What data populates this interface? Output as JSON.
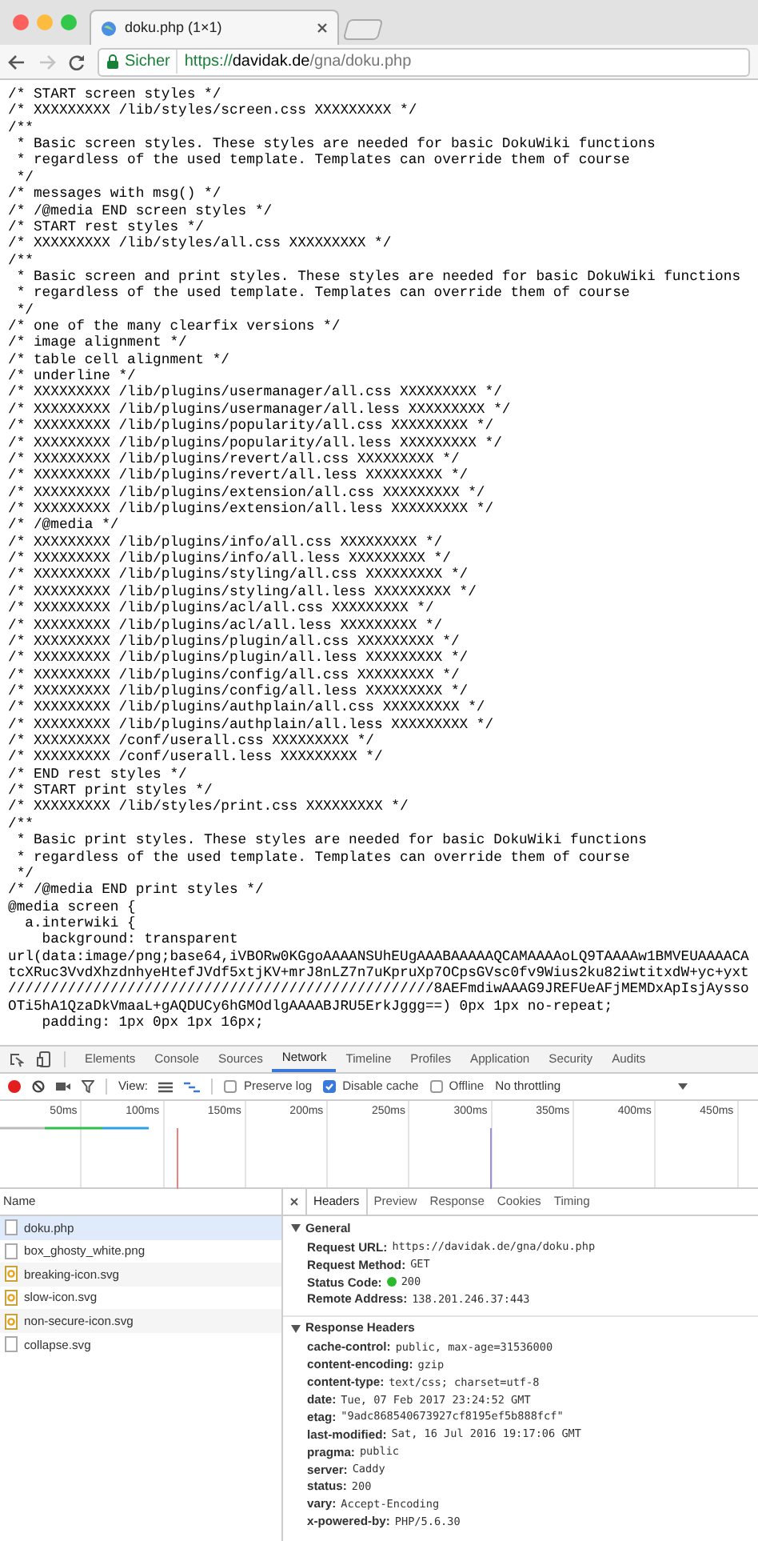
{
  "browser": {
    "tab_title": "doku.php (1×1)",
    "security_label": "Sicher",
    "url": {
      "scheme": "https://",
      "host": "davidak.de",
      "path": "/gna/doku.php"
    }
  },
  "source_lines": [
    "/* START screen styles */",
    "/* XXXXXXXXX /lib/styles/screen.css XXXXXXXXX */",
    "/**",
    " * Basic screen styles. These styles are needed for basic DokuWiki functions",
    " * regardless of the used template. Templates can override them of course",
    " */",
    "/* messages with msg() */",
    "/* /@media END screen styles */",
    "/* START rest styles */",
    "/* XXXXXXXXX /lib/styles/all.css XXXXXXXXX */",
    "/**",
    " * Basic screen and print styles. These styles are needed for basic DokuWiki functions",
    " * regardless of the used template. Templates can override them of course",
    " */",
    "/* one of the many clearfix versions */",
    "/* image alignment */",
    "/* table cell alignment */",
    "/* underline */",
    "/* XXXXXXXXX /lib/plugins/usermanager/all.css XXXXXXXXX */",
    "/* XXXXXXXXX /lib/plugins/usermanager/all.less XXXXXXXXX */",
    "/* XXXXXXXXX /lib/plugins/popularity/all.css XXXXXXXXX */",
    "/* XXXXXXXXX /lib/plugins/popularity/all.less XXXXXXXXX */",
    "/* XXXXXXXXX /lib/plugins/revert/all.css XXXXXXXXX */",
    "/* XXXXXXXXX /lib/plugins/revert/all.less XXXXXXXXX */",
    "/* XXXXXXXXX /lib/plugins/extension/all.css XXXXXXXXX */",
    "/* XXXXXXXXX /lib/plugins/extension/all.less XXXXXXXXX */",
    "/* /@media */",
    "/* XXXXXXXXX /lib/plugins/info/all.css XXXXXXXXX */",
    "/* XXXXXXXXX /lib/plugins/info/all.less XXXXXXXXX */",
    "/* XXXXXXXXX /lib/plugins/styling/all.css XXXXXXXXX */",
    "/* XXXXXXXXX /lib/plugins/styling/all.less XXXXXXXXX */",
    "/* XXXXXXXXX /lib/plugins/acl/all.css XXXXXXXXX */",
    "/* XXXXXXXXX /lib/plugins/acl/all.less XXXXXXXXX */",
    "/* XXXXXXXXX /lib/plugins/plugin/all.css XXXXXXXXX */",
    "/* XXXXXXXXX /lib/plugins/plugin/all.less XXXXXXXXX */",
    "/* XXXXXXXXX /lib/plugins/config/all.css XXXXXXXXX */",
    "/* XXXXXXXXX /lib/plugins/config/all.less XXXXXXXXX */",
    "/* XXXXXXXXX /lib/plugins/authplain/all.css XXXXXXXXX */",
    "/* XXXXXXXXX /lib/plugins/authplain/all.less XXXXXXXXX */",
    "/* XXXXXXXXX /conf/userall.css XXXXXXXXX */",
    "/* XXXXXXXXX /conf/userall.less XXXXXXXXX */",
    "/* END rest styles */",
    "/* START print styles */",
    "/* XXXXXXXXX /lib/styles/print.css XXXXXXXXX */",
    "/**",
    " * Basic print styles. These styles are needed for basic DokuWiki functions",
    " * regardless of the used template. Templates can override them of course",
    " */",
    "/* /@media END print styles */",
    "@media screen {",
    "  a.interwiki {",
    "    background: transparent",
    "url(data:image/png;base64,iVBORw0KGgoAAAANSUhEUgAAABAAAAAQCAMAAAAoLQ9TAAAAw1BMVEUAAAACA",
    "tcXRuc3VvdXhzdnhyeHtefJVdf5xtjKV+mrJ8nLZ7n7uKpruXp7OCpsGVsc0fv9Wius2ku82iwtitxdW+yc+yxt",
    "//////////////////////////////////////////////////8AEFmdiwAAAG9JREFUeAFjMEMDxApIsjAysso",
    "OTi5hA1QzaDkVmaaL+gAQDUCy6hGMOdlgAAAABJRU5ErkJggg==) 0px 1px no-repeat;",
    "    padding: 1px 0px 1px 16px;"
  ],
  "devtools": {
    "tabs": [
      {
        "label": "Elements",
        "selected": false
      },
      {
        "label": "Console",
        "selected": false
      },
      {
        "label": "Sources",
        "selected": false
      },
      {
        "label": "Network",
        "selected": true
      },
      {
        "label": "Timeline",
        "selected": false
      },
      {
        "label": "Profiles",
        "selected": false
      },
      {
        "label": "Application",
        "selected": false
      },
      {
        "label": "Security",
        "selected": false
      },
      {
        "label": "Audits",
        "selected": false
      }
    ],
    "toolbar": {
      "recording": true,
      "view_label": "View:",
      "checkboxes": [
        {
          "label": "Preserve log",
          "checked": false
        },
        {
          "label": "Disable cache",
          "checked": true
        },
        {
          "label": "Offline",
          "checked": false
        }
      ],
      "throttling": "No throttling"
    },
    "timeline_ticks": [
      "50ms",
      "100ms",
      "150ms",
      "200ms",
      "250ms",
      "300ms",
      "350ms",
      "400ms",
      "450ms"
    ],
    "name_column": "Name",
    "files": [
      {
        "name": "doku.php",
        "kind": "document",
        "selected": true
      },
      {
        "name": "box_ghosty_white.png",
        "kind": "document",
        "selected": false
      },
      {
        "name": "breaking-icon.svg",
        "kind": "svg",
        "selected": false
      },
      {
        "name": "slow-icon.svg",
        "kind": "svg",
        "selected": false
      },
      {
        "name": "non-secure-icon.svg",
        "kind": "svg",
        "selected": false
      },
      {
        "name": "collapse.svg",
        "kind": "document",
        "selected": false
      }
    ],
    "detail_tabs": [
      {
        "label": "Headers",
        "selected": true
      },
      {
        "label": "Preview",
        "selected": false
      },
      {
        "label": "Response",
        "selected": false
      },
      {
        "label": "Cookies",
        "selected": false
      },
      {
        "label": "Timing",
        "selected": false
      }
    ],
    "sections": [
      {
        "title": "General",
        "expanded": true,
        "rows": [
          {
            "key": "Request URL:",
            "value": "https://davidak.de/gna/doku.php"
          },
          {
            "key": "Request Method:",
            "value": "GET"
          },
          {
            "key": "Status Code:",
            "value": "200",
            "color": "#2eb82e"
          },
          {
            "key": "Remote Address:",
            "value": "138.201.246.37:443"
          }
        ]
      },
      {
        "title": "Response Headers",
        "expanded": true,
        "rows": [
          {
            "key": "cache-control:",
            "value": "public, max-age=31536000"
          },
          {
            "key": "content-encoding:",
            "value": "gzip"
          },
          {
            "key": "content-type:",
            "value": "text/css; charset=utf-8"
          },
          {
            "key": "date:",
            "value": "Tue, 07 Feb 2017 23:24:52 GMT"
          },
          {
            "key": "etag:",
            "value": "\"9adc868540673927cf8195ef5b888fcf\""
          },
          {
            "key": "last-modified:",
            "value": "Sat, 16 Jul 2016 19:17:06 GMT"
          },
          {
            "key": "pragma:",
            "value": "public"
          },
          {
            "key": "server:",
            "value": "Caddy"
          },
          {
            "key": "status:",
            "value": "200"
          },
          {
            "key": "vary:",
            "value": "Accept-Encoding"
          },
          {
            "key": "x-powered-by:",
            "value": "PHP/5.6.30"
          }
        ]
      }
    ]
  }
}
